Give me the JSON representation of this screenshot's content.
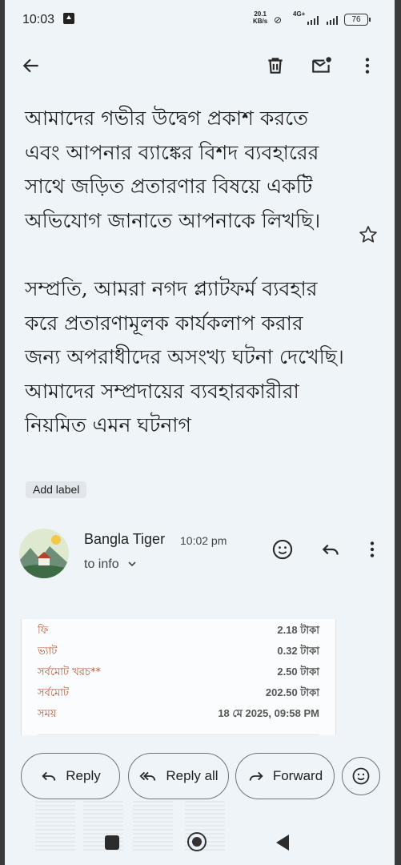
{
  "status_bar": {
    "time": "10:03",
    "speed_value": "20.1",
    "speed_unit": "KB/s",
    "network": "4G+",
    "battery": "76"
  },
  "app_bar": {
    "icons": [
      "back-arrow-icon",
      "delete-icon",
      "mark-unread-icon",
      "more-vert-icon"
    ]
  },
  "message": {
    "paragraph_1": "আমাদের গভীর উদ্বেগ প্রকাশ করতে এবং আপনার ব্যাঙ্কের বিশদ ব্যবহারের সাথে জড়িত প্রতারণার বিষয়ে একটি অভিযোগ জানাতে আপনাকে লিখছি।",
    "paragraph_2": "সম্প্রতি, আমরা নগদ প্ল্যাটফর্ম ব্যবহার করে প্রতারণামূলক কার্যকলাপ করার জন্য অপরাধীদের অসংখ্য ঘটনা দেখেছি। আমাদের সম্প্রদায়ের ব্যবহারকারীরা নিয়মিত এমন ঘটনাগ",
    "add_label": "Add label"
  },
  "sender": {
    "name": "Bangla Tiger",
    "time": "10:02 pm",
    "recipient": "to info"
  },
  "receipt": {
    "rows": [
      {
        "label": "ফি",
        "value": "2.18 টাকা"
      },
      {
        "label": "ভ্যাট",
        "value": "0.32 টাকা"
      },
      {
        "label": "সর্বমোট খরচ**",
        "value": "2.50 টাকা"
      },
      {
        "label": "সর্বমোট",
        "value": "202.50 টাকা"
      },
      {
        "label": "সময়",
        "value": "18 মে 2025, 09:58 PM"
      }
    ]
  },
  "actions": {
    "reply": "Reply",
    "reply_all": "Reply all",
    "forward": "Forward"
  },
  "colors": {
    "background": "#eef4f8",
    "receipt_label": "#b25b3c",
    "text": "#1f1f1f"
  }
}
